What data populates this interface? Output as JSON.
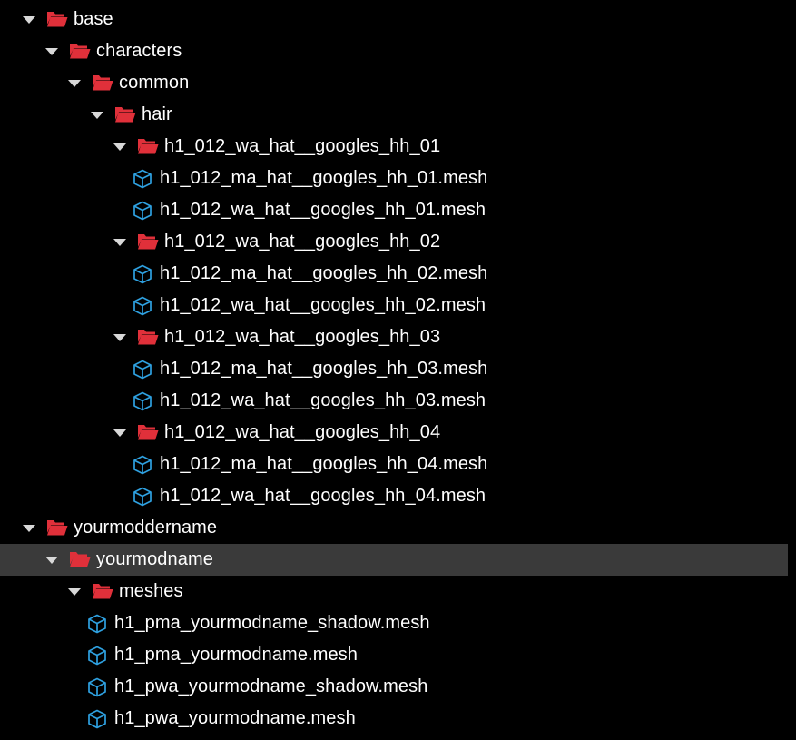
{
  "theme": {
    "background": "#000000",
    "selection": "#3a3a3a",
    "folder_color": "#e0303a",
    "mesh_icon_color": "#2ea0e0",
    "text_color": "#ffffff"
  },
  "tree": [
    {
      "type": "folder",
      "depth": 0,
      "label": "base",
      "expanded": true,
      "icon": "folder-open-icon"
    },
    {
      "type": "folder",
      "depth": 1,
      "label": "characters",
      "expanded": true,
      "icon": "folder-open-icon"
    },
    {
      "type": "folder",
      "depth": 2,
      "label": "common",
      "expanded": true,
      "icon": "folder-open-icon"
    },
    {
      "type": "folder",
      "depth": 3,
      "label": "hair",
      "expanded": true,
      "icon": "folder-open-icon"
    },
    {
      "type": "folder",
      "depth": 4,
      "label": "h1_012_wa_hat__googles_hh_01",
      "expanded": true,
      "icon": "folder-open-icon"
    },
    {
      "type": "file",
      "depth": 5,
      "label": "h1_012_ma_hat__googles_hh_01.mesh",
      "icon": "mesh-cube-icon"
    },
    {
      "type": "file",
      "depth": 5,
      "label": "h1_012_wa_hat__googles_hh_01.mesh",
      "icon": "mesh-cube-icon"
    },
    {
      "type": "folder",
      "depth": 4,
      "label": "h1_012_wa_hat__googles_hh_02",
      "expanded": true,
      "icon": "folder-open-icon"
    },
    {
      "type": "file",
      "depth": 5,
      "label": "h1_012_ma_hat__googles_hh_02.mesh",
      "icon": "mesh-cube-icon"
    },
    {
      "type": "file",
      "depth": 5,
      "label": "h1_012_wa_hat__googles_hh_02.mesh",
      "icon": "mesh-cube-icon"
    },
    {
      "type": "folder",
      "depth": 4,
      "label": "h1_012_wa_hat__googles_hh_03",
      "expanded": true,
      "icon": "folder-open-icon"
    },
    {
      "type": "file",
      "depth": 5,
      "label": "h1_012_ma_hat__googles_hh_03.mesh",
      "icon": "mesh-cube-icon"
    },
    {
      "type": "file",
      "depth": 5,
      "label": "h1_012_wa_hat__googles_hh_03.mesh",
      "icon": "mesh-cube-icon"
    },
    {
      "type": "folder",
      "depth": 4,
      "label": "h1_012_wa_hat__googles_hh_04",
      "expanded": true,
      "icon": "folder-open-icon"
    },
    {
      "type": "file",
      "depth": 5,
      "label": "h1_012_ma_hat__googles_hh_04.mesh",
      "icon": "mesh-cube-icon"
    },
    {
      "type": "file",
      "depth": 5,
      "label": "h1_012_wa_hat__googles_hh_04.mesh",
      "icon": "mesh-cube-icon"
    },
    {
      "type": "folder",
      "depth": 0,
      "label": "yourmoddername",
      "expanded": true,
      "icon": "folder-open-icon"
    },
    {
      "type": "folder",
      "depth": 1,
      "label": "yourmodname",
      "expanded": true,
      "selected": true,
      "icon": "folder-open-icon"
    },
    {
      "type": "folder",
      "depth": 2,
      "label": "meshes",
      "expanded": true,
      "icon": "folder-open-icon"
    },
    {
      "type": "file",
      "depth": 3,
      "label": "h1_pma_yourmodname_shadow.mesh",
      "icon": "mesh-cube-icon"
    },
    {
      "type": "file",
      "depth": 3,
      "label": "h1_pma_yourmodname.mesh",
      "icon": "mesh-cube-icon"
    },
    {
      "type": "file",
      "depth": 3,
      "label": "h1_pwa_yourmodname_shadow.mesh",
      "icon": "mesh-cube-icon"
    },
    {
      "type": "file",
      "depth": 3,
      "label": "h1_pwa_yourmodname.mesh",
      "icon": "mesh-cube-icon"
    }
  ]
}
